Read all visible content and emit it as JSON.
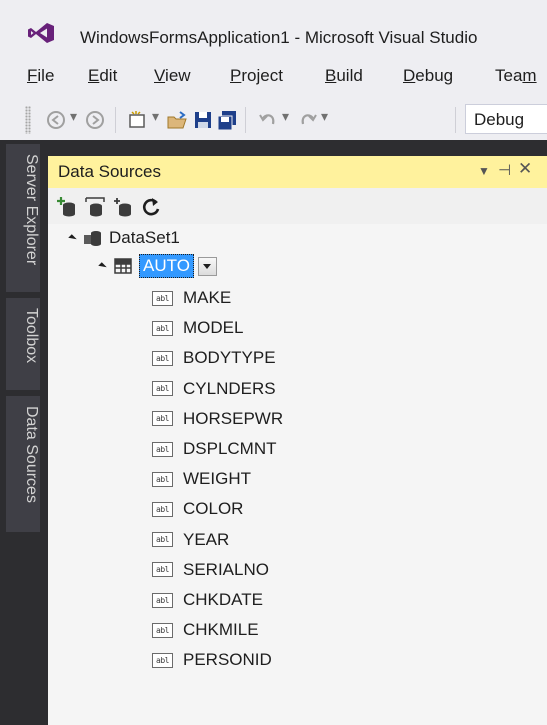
{
  "window": {
    "title": "WindowsFormsApplication1 - Microsoft Visual Studio",
    "app_icon": "visual-studio-logo-icon",
    "accent_color": "#68217a"
  },
  "menu": {
    "items": [
      {
        "prefix": "",
        "ul": "F",
        "rest": "ile"
      },
      {
        "prefix": "",
        "ul": "E",
        "rest": "dit"
      },
      {
        "prefix": "",
        "ul": "V",
        "rest": "iew"
      },
      {
        "prefix": "",
        "ul": "P",
        "rest": "roject"
      },
      {
        "prefix": "",
        "ul": "B",
        "rest": "uild"
      },
      {
        "prefix": "",
        "ul": "D",
        "rest": "ebug"
      },
      {
        "prefix": "Tea",
        "ul": "m",
        "rest": ""
      }
    ]
  },
  "toolbar": {
    "icons": [
      "back-icon",
      "forward-icon",
      "new-project-icon",
      "open-file-icon",
      "save-icon",
      "save-all-icon",
      "undo-icon",
      "redo-icon"
    ],
    "configuration": "Debug"
  },
  "side_tabs": [
    "Server Explorer",
    "Toolbox",
    "Data Sources"
  ],
  "panel": {
    "title": "Data Sources",
    "header_color": "#fff29d",
    "header_buttons": [
      "dropdown-arrow-icon",
      "pin-icon",
      "close-icon"
    ],
    "toolbar_icons": [
      "add-new-data-source-icon",
      "edit-dataset-designer-icon",
      "configure-dataset-icon",
      "refresh-icon"
    ]
  },
  "tree": {
    "dataset": "DataSet1",
    "table": "AUTO",
    "fields": [
      "MAKE",
      "MODEL",
      "BODYTYPE",
      "CYLNDERS",
      "HORSEPWR",
      "DSPLCMNT",
      "WEIGHT",
      "COLOR",
      "YEAR",
      "SERIALNO",
      "CHKDATE",
      "CHKMILE",
      "PERSONID"
    ],
    "field_icon_text": "abl"
  }
}
